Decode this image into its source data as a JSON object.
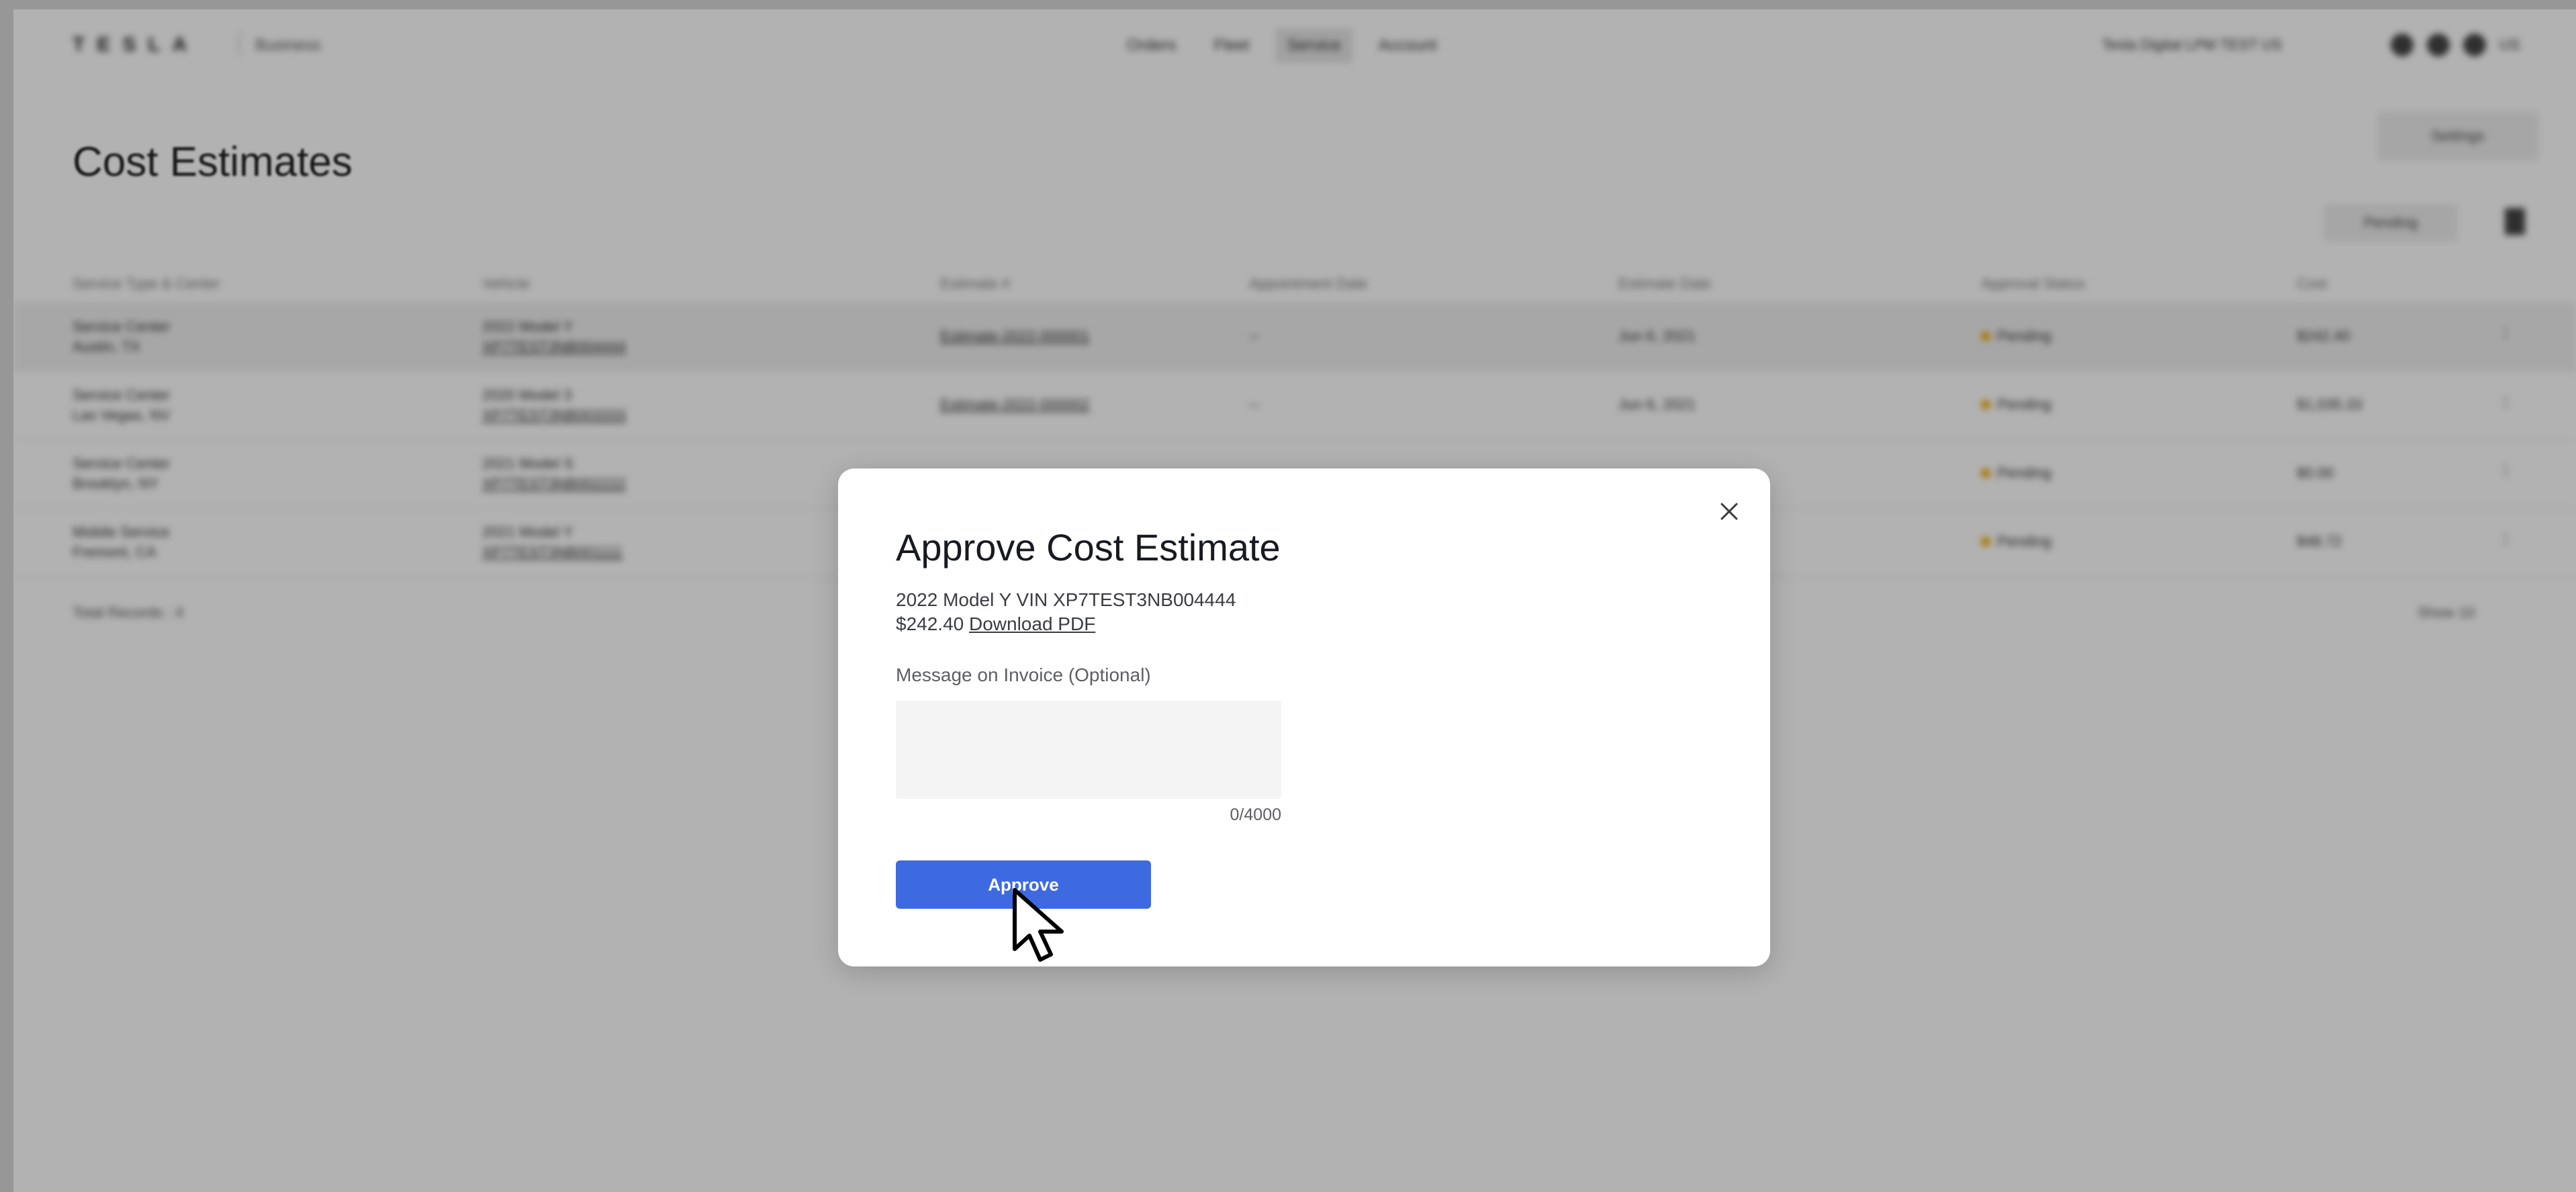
{
  "nav": {
    "logo": "TESLA",
    "logo_sub": "Business",
    "tabs": [
      {
        "label": "Orders"
      },
      {
        "label": "Fleet"
      },
      {
        "label": "Service"
      },
      {
        "label": "Account"
      }
    ],
    "account": "Tesla Digital LPM TEST US",
    "language": "US"
  },
  "page": {
    "title": "Cost Estimates",
    "settings_label": "Settings",
    "filter_chip": "Pending",
    "columns": [
      "Service Type & Center",
      "Vehicle",
      "Estimate #",
      "Appointment Date",
      "Estimate Date",
      "Approval Status",
      "Cost"
    ],
    "rows": [
      {
        "center": "Service Center",
        "city": "Austin, TX",
        "vehicle": "2022 Model Y",
        "vin": "XP7TEST3NB004444",
        "estimate": "Estimate-2022-000001",
        "appt": "--",
        "date": "Jun 6, 2021",
        "status": "Pending",
        "cost": "$242.40"
      },
      {
        "center": "Service Center",
        "city": "Las Vegas, NV",
        "vehicle": "2020 Model 3",
        "vin": "XP7TEST3NB003333",
        "estimate": "Estimate-2022-000002",
        "appt": "--",
        "date": "Jun 6, 2021",
        "status": "Pending",
        "cost": "$1,035.33"
      },
      {
        "center": "Service Center",
        "city": "Brooklyn, NY",
        "vehicle": "2021 Model S",
        "vin": "XP7TEST3NB002222",
        "estimate": "",
        "appt": "",
        "date": "",
        "status": "Pending",
        "cost": "$0.00"
      },
      {
        "center": "Mobile Service",
        "city": "Fremont, CA",
        "vehicle": "2021 Model Y",
        "vin": "XP7TEST3NB001111",
        "estimate": "",
        "appt": "",
        "date": "",
        "status": "Pending",
        "cost": "$48.72"
      }
    ],
    "total_records": "Total Records : 4",
    "show": "Show 10"
  },
  "modal": {
    "title": "Approve Cost Estimate",
    "vehicle_line": "2022 Model Y VIN XP7TEST3NB004444",
    "price": "$242.40",
    "download_label": "Download PDF",
    "message_label": "Message on Invoice (Optional)",
    "message_value": "",
    "char_count": "0/4000",
    "approve_label": "Approve"
  },
  "colors": {
    "primary_button": "#3e6ae1",
    "status_pending": "#f2a900",
    "textarea_bg": "#f4f4f4"
  }
}
